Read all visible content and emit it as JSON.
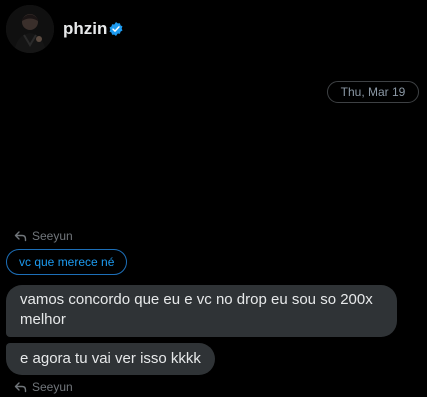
{
  "header": {
    "username": "phzin",
    "verified_icon": "verified-badge-icon",
    "verified_color": "#1d9bf0"
  },
  "conversation": {
    "date_separator": "Thu, Mar 19",
    "reply_to_1": "Seeyun",
    "quoted_message": "vc que merece né",
    "messages": [
      {
        "text": "vamos concordo que eu e vc no drop eu sou so 200x melhor"
      },
      {
        "text": "e agora tu vai ver isso kkkk"
      }
    ],
    "reply_to_2": "Seeyun"
  },
  "colors": {
    "background": "#000000",
    "bubble": "#2f3336",
    "accent": "#1d9bf0",
    "muted_text": "#71767b"
  }
}
